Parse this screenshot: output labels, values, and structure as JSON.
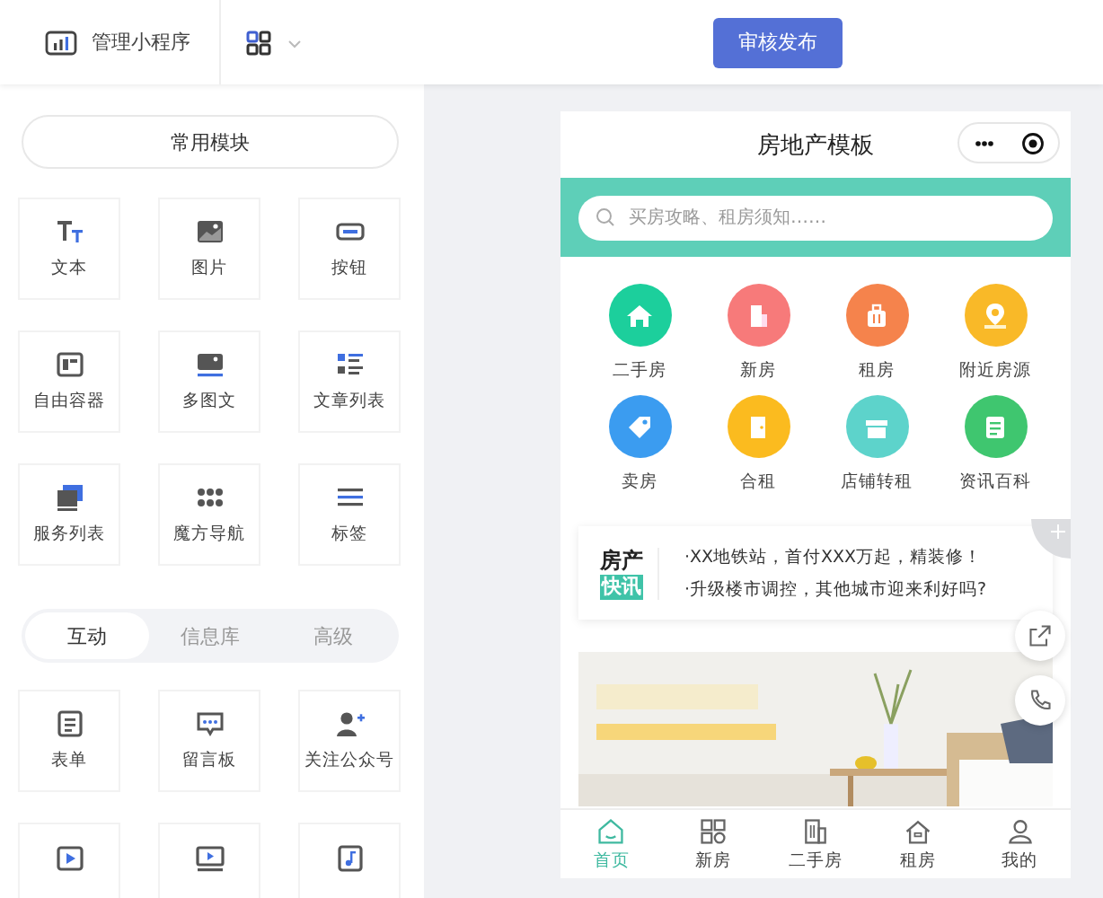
{
  "topbar": {
    "manage_label": "管理小程序",
    "publish_button": "审核发布"
  },
  "common_modules": {
    "title": "常用模块",
    "tiles": [
      {
        "label": "文本"
      },
      {
        "label": "图片"
      },
      {
        "label": "按钮"
      },
      {
        "label": "自由容器"
      },
      {
        "label": "多图文"
      },
      {
        "label": "文章列表"
      },
      {
        "label": "服务列表"
      },
      {
        "label": "魔方导航"
      },
      {
        "label": "标签"
      }
    ]
  },
  "category_tabs": [
    {
      "label": "互动",
      "selected": true
    },
    {
      "label": "信息库",
      "selected": false
    },
    {
      "label": "高级",
      "selected": false
    }
  ],
  "interaction_tiles": [
    {
      "label": "表单"
    },
    {
      "label": "留言板"
    },
    {
      "label": "关注公众号"
    },
    {
      "kind": "icon_only"
    },
    {
      "kind": "icon_only"
    },
    {
      "kind": "icon_only"
    }
  ],
  "phone": {
    "title": "房地产模板",
    "search": {
      "placeholder": "买房攻略、租房须知……"
    },
    "shortcuts": [
      {
        "label": "二手房",
        "color": "#1ccf9c"
      },
      {
        "label": "新房",
        "color": "#f77a7a"
      },
      {
        "label": "租房",
        "color": "#f5834c"
      },
      {
        "label": "附近房源",
        "color": "#f9b928"
      },
      {
        "label": "卖房",
        "color": "#3b9cf0"
      },
      {
        "label": "合租",
        "color": "#fbbb1f"
      },
      {
        "label": "店铺转租",
        "color": "#5dd3cb"
      },
      {
        "label": "资讯百科",
        "color": "#3fc66f"
      }
    ],
    "news": {
      "logo_top": "房产",
      "logo_bottom": "快讯",
      "lines": [
        "·XX地铁站，首付XXX万起，精装修！",
        "·升级楼市调控，其他城市迎来利好吗?"
      ]
    },
    "tab_bar": [
      {
        "label": "首页",
        "selected": true
      },
      {
        "label": "新房",
        "selected": false
      },
      {
        "label": "二手房",
        "selected": false
      },
      {
        "label": "租房",
        "selected": false
      },
      {
        "label": "我的",
        "selected": false
      }
    ]
  }
}
